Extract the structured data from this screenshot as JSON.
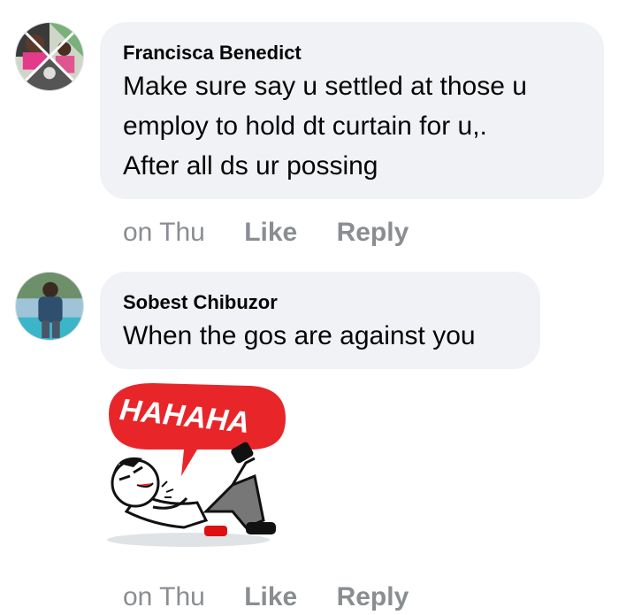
{
  "comments": [
    {
      "author": "Francisca Benedict",
      "text_lines": [
        "Make sure say u settled at those u",
        "employ to hold dt curtain for u,.",
        "After all ds ur possing"
      ],
      "time": "on Thu",
      "like_label": "Like",
      "reply_label": "Reply"
    },
    {
      "author": "Sobest Chibuzor",
      "text_lines": [
        "When the gos are against you"
      ],
      "sticker_text": "HAHAHA",
      "time": "on Thu",
      "like_label": "Like",
      "reply_label": "Reply"
    }
  ],
  "colors": {
    "bubble_bg": "#f0f2f5",
    "meta_text": "#8a8d91",
    "sticker_red": "#e8262a"
  }
}
